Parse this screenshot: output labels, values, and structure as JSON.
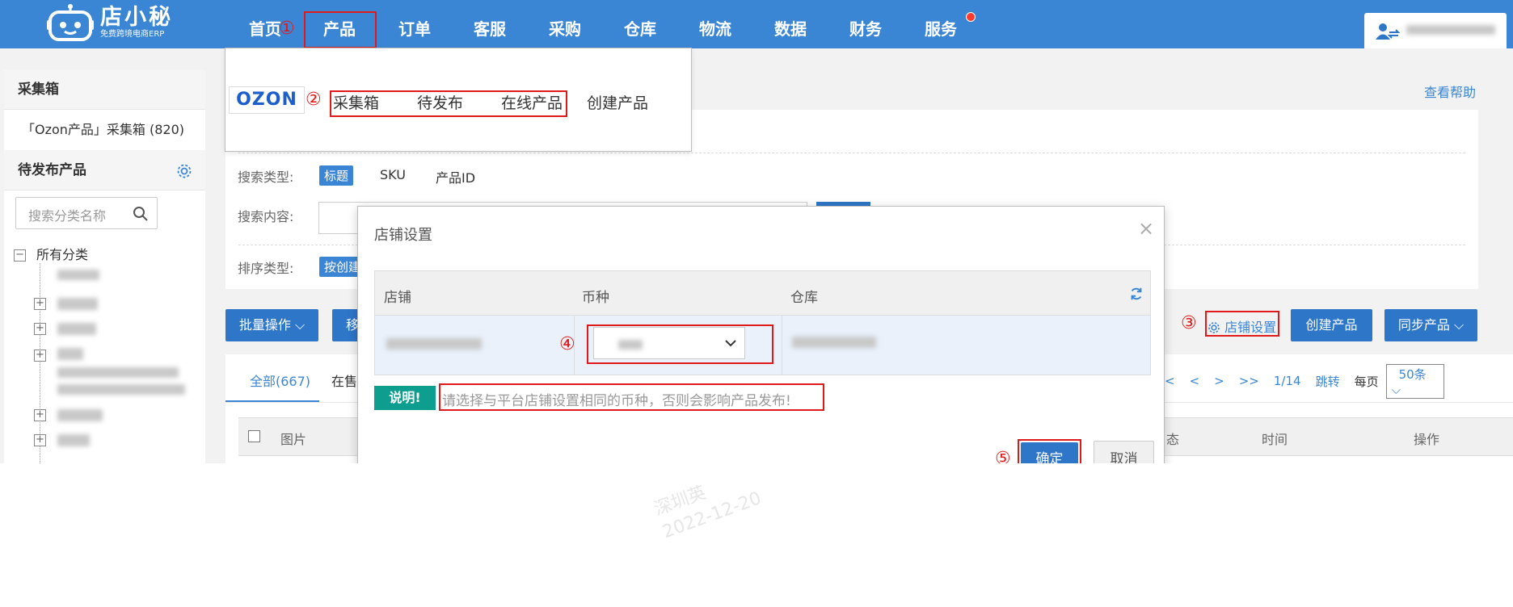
{
  "colors": {
    "nav_bg": "#3b86d4",
    "accent": "#2e76c8",
    "annotation": "#e01a1a",
    "note_tag": "#0e9e8f"
  },
  "logo": {
    "title": "店小秘",
    "subtitle": "免费跨境电商ERP"
  },
  "nav": {
    "items": [
      "首页",
      "产品",
      "订单",
      "客服",
      "采购",
      "仓库",
      "物流",
      "数据",
      "财务",
      "服务"
    ],
    "active": "产品"
  },
  "annotations": {
    "n1": "①",
    "n2": "②",
    "n3": "③",
    "n4": "④",
    "n5": "⑤"
  },
  "sidebar": {
    "header1": "采集箱",
    "item1": "「Ozon产品」采集箱 (820)",
    "header2": "待发布产品",
    "search_placeholder": "搜索分类名称",
    "all_categories": "所有分类",
    "icons": {
      "settings": "gear-icon",
      "search": "search-icon"
    }
  },
  "main": {
    "help_link": "查看帮助",
    "search_type_label": "搜索类型:",
    "search_types": [
      "标题",
      "SKU",
      "产品ID"
    ],
    "search_content_label": "搜索内容:",
    "sort_type_label": "排序类型:",
    "sort_tag": "按创建",
    "batch_button": "批量操作",
    "move_button": "移",
    "store_settings_link": "店铺设置",
    "create_product_button": "创建产品",
    "sync_product_button": "同步产品"
  },
  "tabs": {
    "all": "全部(667)",
    "on_sale": "在售"
  },
  "pager": {
    "first": "<",
    "prev": "<",
    "next": ">",
    "last": ">>",
    "page": "1/14",
    "jump": "跳转",
    "per_page_label": "每页",
    "per_page_value": "50条"
  },
  "table_headers": {
    "select": "",
    "image": "图片",
    "status": "态",
    "time": "时间",
    "actions": "操作"
  },
  "menu": {
    "platform_logo": "OZON",
    "links": [
      "采集箱",
      "待发布",
      "在线产品",
      "创建产品"
    ]
  },
  "modal": {
    "title": "店铺设置",
    "close": "×",
    "columns": {
      "store": "店铺",
      "currency": "币种",
      "warehouse": "仓库"
    },
    "note_tag": "说明!",
    "note_text": "请选择与平台店铺设置相同的币种，否则会影响产品发布!",
    "ok": "确定",
    "cancel": "取消"
  },
  "watermark": {
    "line1": "深圳英",
    "line2": "2022-12-20"
  }
}
